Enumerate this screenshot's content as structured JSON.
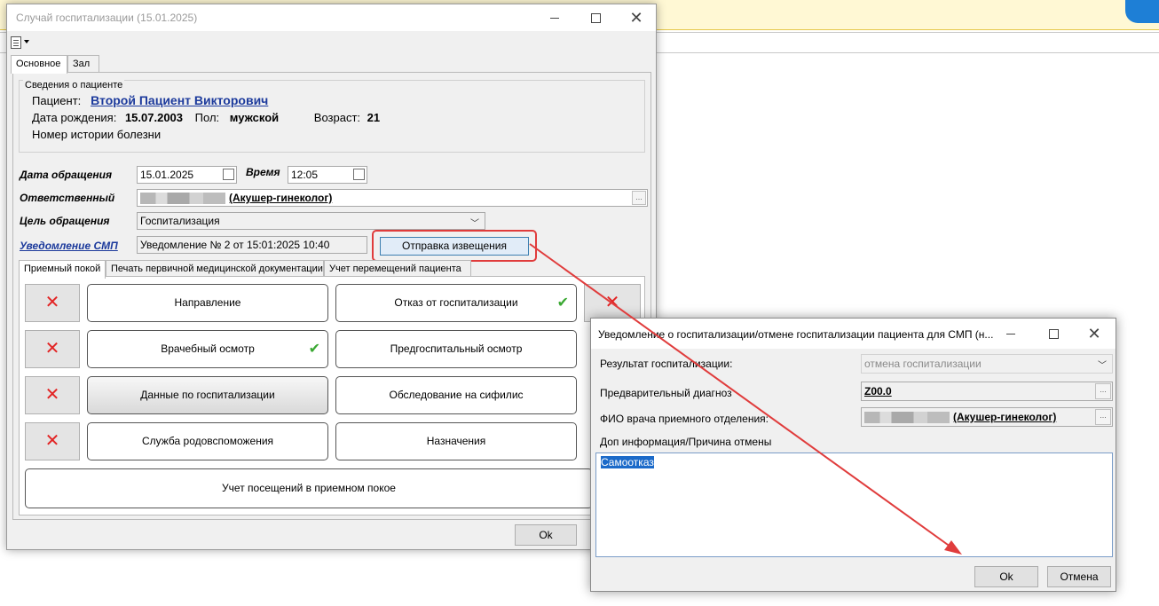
{
  "main_window": {
    "title": "Случай госпитализации (15.01.2025)",
    "tabs": [
      "Основное",
      "Зал"
    ],
    "patient_group": {
      "legend": "Сведения о пациенте",
      "patient_label": "Пациент:",
      "patient_name": "Второй Пациент Викторович",
      "dob_label": "Дата рождения:",
      "dob": "15.07.2003",
      "sex_label": "Пол:",
      "sex": "мужской",
      "age_label": "Возраст:",
      "age": "21",
      "history_label": "Номер истории болезни"
    },
    "form": {
      "date_label": "Дата обращения",
      "date_value": "15.01.2025",
      "time_label": "Время",
      "time_value": "12:05",
      "responsible_label": "Ответственный",
      "responsible_role": "(Акушер-гинеколог)",
      "goal_label": "Цель обращения",
      "goal_value": "Госпитализация",
      "smp_label": "Уведомление СМП",
      "smp_value": "Уведомление № 2 от 15:01:2025 10:40",
      "send_button": "Отправка извещения"
    },
    "inner_tabs": [
      "Приемный покой",
      "Печать первичной медицинской документации",
      "Учет перемещений пациента"
    ],
    "actions": [
      {
        "label": "Направление",
        "done": false
      },
      {
        "label": "Отказ от госпитализации",
        "done": true
      },
      {
        "label": "Врачебный осмотр",
        "done": true
      },
      {
        "label": "Предгоспитальный осмотр",
        "done": false
      },
      {
        "label": "Данные по госпитализации",
        "done": false
      },
      {
        "label": "Обследование на сифилис",
        "done": false
      },
      {
        "label": "Служба родовспоможения",
        "done": false
      },
      {
        "label": "Назначения",
        "done": false
      }
    ],
    "visits_button": "Учет посещений в приемном покое",
    "ok_button": "Ok"
  },
  "dialog": {
    "title": "Уведомление о госпитализации/отмене госпитализации пациента для СМП (н...",
    "result_label": "Результат госпитализации:",
    "result_value": "отмена госпитализации",
    "diagnosis_label": "Предварительный диагноз",
    "diagnosis_value": "Z00.0",
    "doctor_label": "ФИО врача приемного отделения:",
    "doctor_role": "(Акушер-гинеколог)",
    "info_label": "Доп информация/Причина отмены",
    "info_value": "Самоотказ",
    "ok_button": "Ok",
    "cancel_button": "Отмена"
  },
  "colors": {
    "link": "#1c3a9c",
    "highlight": "#e03c3c",
    "check": "#3aa832",
    "cross": "#e22424"
  }
}
